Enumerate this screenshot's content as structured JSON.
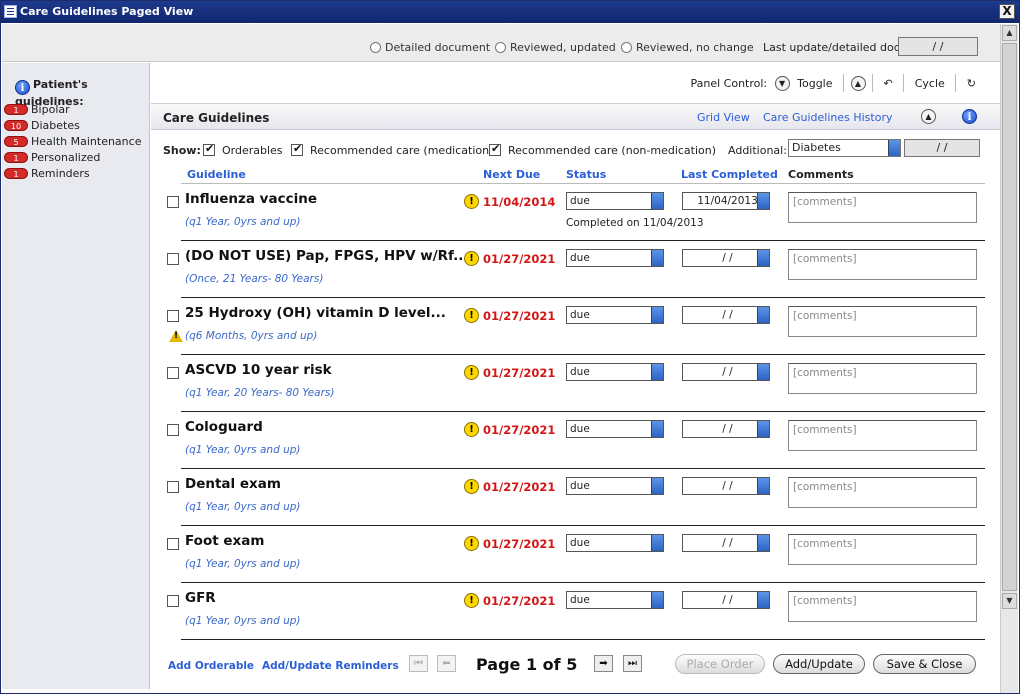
{
  "window": {
    "title": "Care Guidelines Paged View",
    "close": "X"
  },
  "topbar": {
    "options": [
      "Detailed document",
      "Reviewed, updated",
      "Reviewed, no change"
    ],
    "last_update_label": "Last update/detailed doc:",
    "last_update_value": "/ /"
  },
  "sidebar": {
    "title": "Patient's guidelines:",
    "items": [
      {
        "label": "Bipolar",
        "count": "1"
      },
      {
        "label": "Diabetes",
        "count": "10"
      },
      {
        "label": "Health Maintenance",
        "count": "5"
      },
      {
        "label": "Personalized",
        "count": "1"
      },
      {
        "label": "Reminders",
        "count": "1"
      }
    ]
  },
  "panel_control": {
    "label": "Panel Control:",
    "toggle": "Toggle",
    "cycle": "Cycle"
  },
  "header": {
    "title": "Care Guidelines",
    "grid_view": "Grid View",
    "history": "Care Guidelines History"
  },
  "show": {
    "label": "Show:",
    "options": [
      "Orderables",
      "Recommended care (medication)",
      "Recommended care (non-medication)"
    ],
    "additional_label": "Additional:",
    "additional_value": "Diabetes",
    "additional_date": "/ /"
  },
  "columns": {
    "guideline": "Guideline",
    "next_due": "Next Due",
    "status": "Status",
    "last_completed": "Last Completed",
    "comments": "Comments"
  },
  "rows": [
    {
      "name": "Influenza vaccine",
      "freq": "(q1 Year, 0yrs and up)",
      "next_due": "11/04/2014",
      "status": "due",
      "last_completed": "11/04/2013",
      "completed_note": "Completed on 11/04/2013",
      "comment": "[comments]"
    },
    {
      "name": "(DO NOT USE) Pap, FPGS, HPV w/Rf...",
      "freq": "(Once, 21 Years- 80 Years)",
      "next_due": "01/27/2021",
      "status": "due",
      "last_completed": "/ /",
      "completed_note": "",
      "comment": "[comments]"
    },
    {
      "name": "25 Hydroxy (OH) vitamin D level...",
      "freq": "(q6 Months, 0yrs and up)",
      "next_due": "01/27/2021",
      "status": "due",
      "last_completed": "/ /",
      "completed_note": "",
      "comment": "[comments]"
    },
    {
      "name": "ASCVD 10 year risk",
      "freq": "(q1 Year, 20 Years- 80 Years)",
      "next_due": "01/27/2021",
      "status": "due",
      "last_completed": "/ /",
      "completed_note": "",
      "comment": "[comments]"
    },
    {
      "name": "Cologuard",
      "freq": "(q1 Year, 0yrs and up)",
      "next_due": "01/27/2021",
      "status": "due",
      "last_completed": "/ /",
      "completed_note": "",
      "comment": "[comments]"
    },
    {
      "name": "Dental exam",
      "freq": "(q1 Year, 0yrs and up)",
      "next_due": "01/27/2021",
      "status": "due",
      "last_completed": "/ /",
      "completed_note": "",
      "comment": "[comments]"
    },
    {
      "name": "Foot exam",
      "freq": "(q1 Year, 0yrs and up)",
      "next_due": "01/27/2021",
      "status": "due",
      "last_completed": "/ /",
      "completed_note": "",
      "comment": "[comments]"
    },
    {
      "name": "GFR",
      "freq": "(q1 Year, 0yrs and up)",
      "next_due": "01/27/2021",
      "status": "due",
      "last_completed": "/ /",
      "completed_note": "",
      "comment": "[comments]"
    }
  ],
  "footer": {
    "add_orderable": "Add Orderable",
    "add_reminders": "Add/Update Reminders",
    "page_info": "Page 1 of 5",
    "place_order": "Place Order",
    "add_update": "Add/Update",
    "save_close": "Save & Close"
  }
}
